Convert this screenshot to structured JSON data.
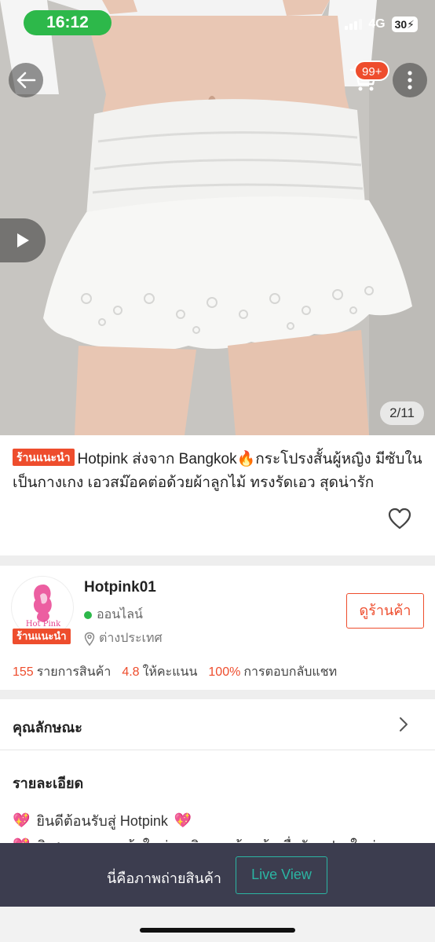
{
  "status_bar": {
    "time": "16:12",
    "network": "4G",
    "battery": "30"
  },
  "gallery": {
    "image_description_icon": "product-photo",
    "counter": "2/11",
    "cart_badge": "99+"
  },
  "product": {
    "tag": "ร้านแนะนำ",
    "title": "Hotpink ส่งจาก Bangkok🔥กระโปรงสั้นผู้หญิง มีซับในเป็นกางเกง เอวสม๊อคต่อด้วยผ้าลูกไม้ ทรงรัดเอว สุดน่ารัก"
  },
  "shop": {
    "logo_text": "Hot Pink",
    "tag": "ร้านแนะนำ",
    "name": "Hotpink01",
    "status": "ออนไลน์",
    "location": "ต่างประเทศ",
    "view_shop_label": "ดูร้านค้า",
    "stats": {
      "products_count": "155",
      "products_label": "รายการสินค้า",
      "rating": "4.8",
      "rating_label": "ให้คะแนน",
      "response_rate": "100%",
      "response_label": "การตอบกลับแชท"
    }
  },
  "sections": {
    "attributes_label": "คุณลักษณะ",
    "details_label": "รายละเอียด",
    "description_line1": "ยินดีต้อนรับสู่ Hotpink",
    "description_line2": "พิเศษเฉพาะลูกค้าใหม่ กดติดตามร้านค้าเพื่อรับคูปองใหม่และ"
  },
  "bottom_bar": {
    "caption": "นี่คือภาพถ่ายสินค้า",
    "live_view_label": "Live View"
  },
  "colors": {
    "accent": "#ee4d2d",
    "online": "#2db84a",
    "live_view": "#2bb5a3",
    "bottom_bar_bg": "#3c3d4f"
  }
}
